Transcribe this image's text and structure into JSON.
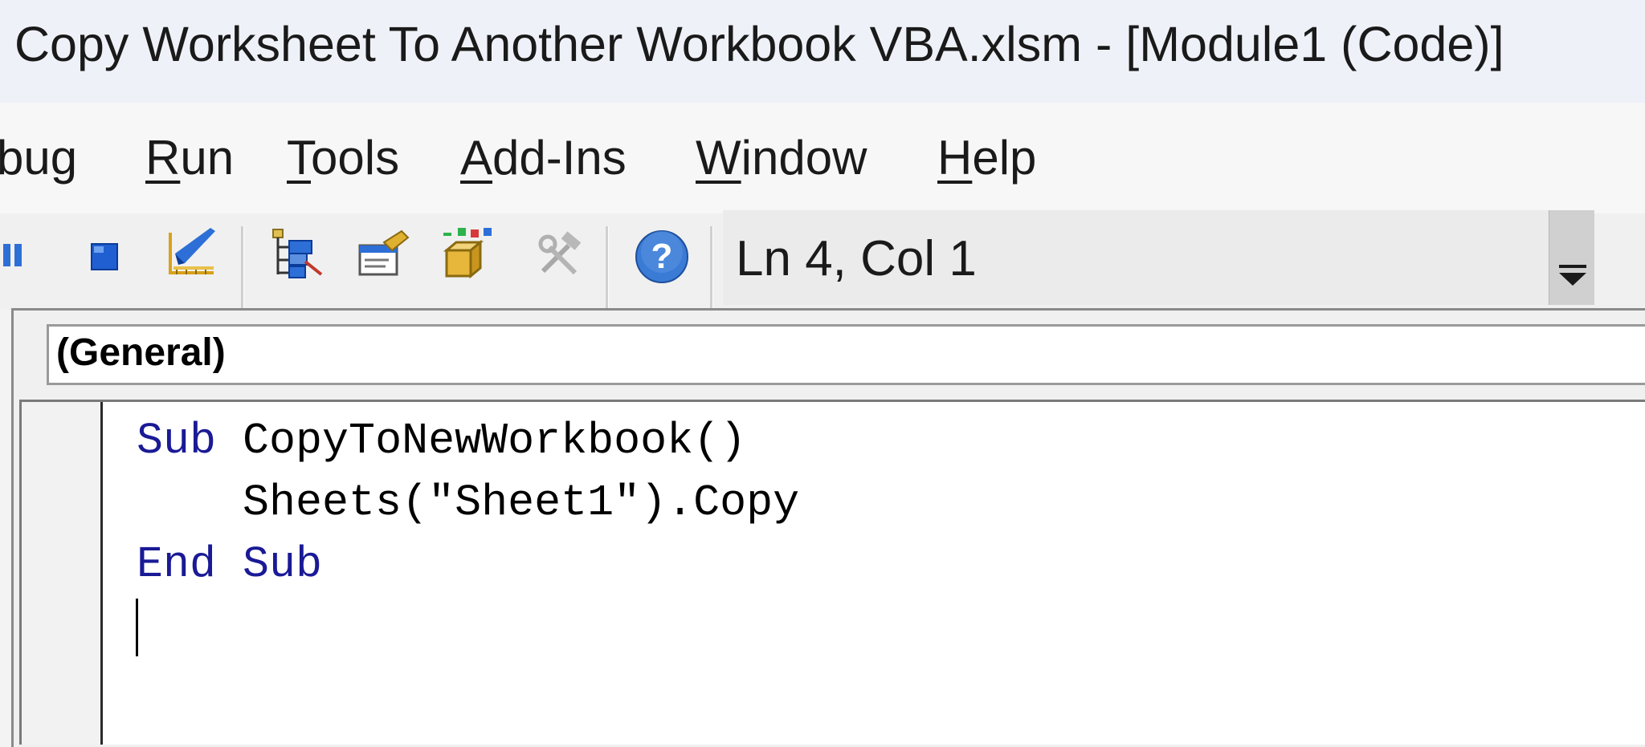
{
  "window": {
    "title": "Copy Worksheet To Another Workbook VBA.xlsm - [Module1 (Code)]"
  },
  "menubar": {
    "items": [
      {
        "underline": "",
        "rest": "bug"
      },
      {
        "underline": "R",
        "rest": "un"
      },
      {
        "underline": "T",
        "rest": "ools"
      },
      {
        "underline": "A",
        "rest": "dd-Ins"
      },
      {
        "underline": "W",
        "rest": "indow"
      },
      {
        "underline": "H",
        "rest": "elp"
      }
    ]
  },
  "toolbar": {
    "icons": [
      "break-icon",
      "reset-icon",
      "design-mode-icon",
      "project-explorer-icon",
      "properties-window-icon",
      "object-browser-icon",
      "toolbox-icon",
      "help-icon"
    ],
    "status": "Ln 4, Col 1"
  },
  "code_window": {
    "object_combo": "(General)",
    "lines": [
      {
        "kw1": "Sub",
        "text": " CopyToNewWorkbook()",
        "kw2": ""
      },
      {
        "kw1": "",
        "text": "    Sheets(\"Sheet1\").Copy",
        "kw2": ""
      },
      {
        "kw1": "End",
        "text": " ",
        "kw2": "Sub"
      },
      {
        "kw1": "",
        "text": "",
        "kw2": ""
      }
    ]
  },
  "colors": {
    "keyword": "#1a1a96",
    "help_blue": "#3a7bd5"
  }
}
